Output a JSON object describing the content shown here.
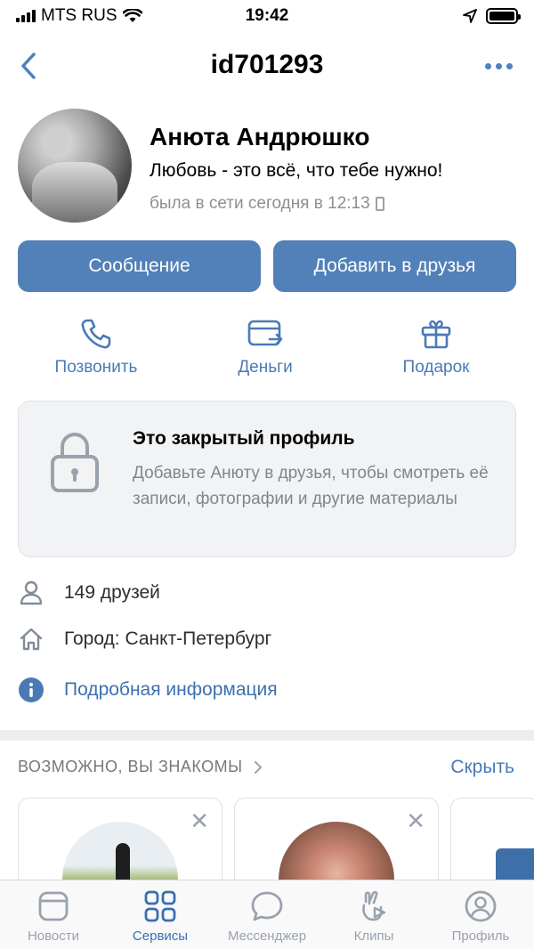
{
  "status_bar": {
    "carrier": "MTS RUS",
    "time": "19:42"
  },
  "nav": {
    "title": "id701293"
  },
  "profile": {
    "name": "Анюта Андрюшко",
    "status": "Любовь - это всё, что тебе нужно!",
    "last_seen": "была в сети сегодня в 12:13"
  },
  "actions": {
    "message": "Сообщение",
    "add_friend": "Добавить в друзья"
  },
  "quick_actions": [
    {
      "label": "Позвонить",
      "icon": "phone-icon"
    },
    {
      "label": "Деньги",
      "icon": "money-transfer-icon"
    },
    {
      "label": "Подарок",
      "icon": "gift-icon"
    }
  ],
  "closed_profile": {
    "title": "Это закрытый профиль",
    "description": "Добавьте Анюту в друзья, чтобы смотреть её записи, фотографии и другие материалы"
  },
  "info": {
    "friends": "149 друзей",
    "city": "Город: Санкт-Петербург",
    "details": "Подробная информация"
  },
  "suggestions": {
    "title": "ВОЗМОЖНО, ВЫ ЗНАКОМЫ",
    "hide": "Скрыть",
    "close_glyph": "✕"
  },
  "tab_bar": [
    {
      "label": "Новости",
      "active": false
    },
    {
      "label": "Сервисы",
      "active": true
    },
    {
      "label": "Мессенджер",
      "active": false
    },
    {
      "label": "Клипы",
      "active": false
    },
    {
      "label": "Профиль",
      "active": false
    }
  ],
  "colors": {
    "accent": "#5181b8",
    "link": "#4a7ab5",
    "muted": "#99a2ad"
  }
}
